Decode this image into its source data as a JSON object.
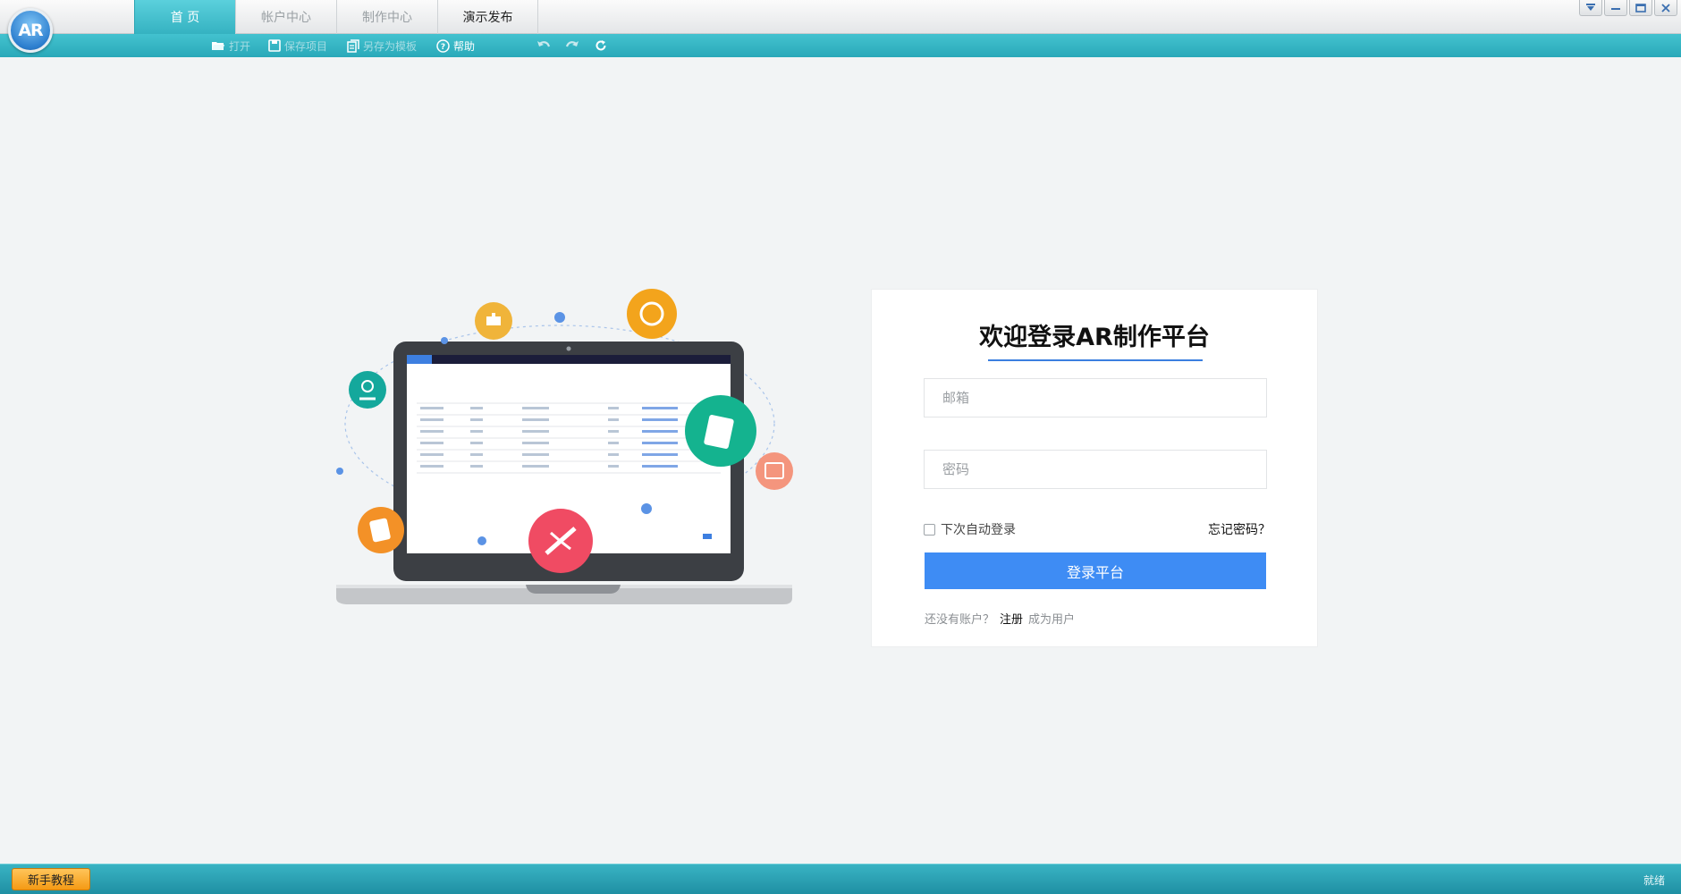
{
  "app": {
    "logo_text": "AR"
  },
  "tabs": [
    {
      "label": "首 页",
      "active": true
    },
    {
      "label": "帐户中心",
      "active": false
    },
    {
      "label": "制作中心",
      "active": false
    },
    {
      "label": "演示发布",
      "active": false
    }
  ],
  "toolbar": {
    "open_label": "打开",
    "save_label": "保存项目",
    "save_as_template_label": "另存为模板",
    "help_label": "帮助"
  },
  "login": {
    "title": "欢迎登录AR制作平台",
    "email_placeholder": "邮箱",
    "password_placeholder": "密码",
    "remember_label": "下次自动登录",
    "forgot_label": "忘记密码？",
    "submit_label": "登录平台",
    "no_account_label": "还没有账户？",
    "register_label": "注册",
    "become_user_label": "成为用户"
  },
  "status": {
    "tutorial_label": "新手教程",
    "state_text": "就绪"
  },
  "colors": {
    "accent": "#2aa9b9",
    "primary_button": "#3e8cf4",
    "tutorial_button": "#f49a14"
  }
}
